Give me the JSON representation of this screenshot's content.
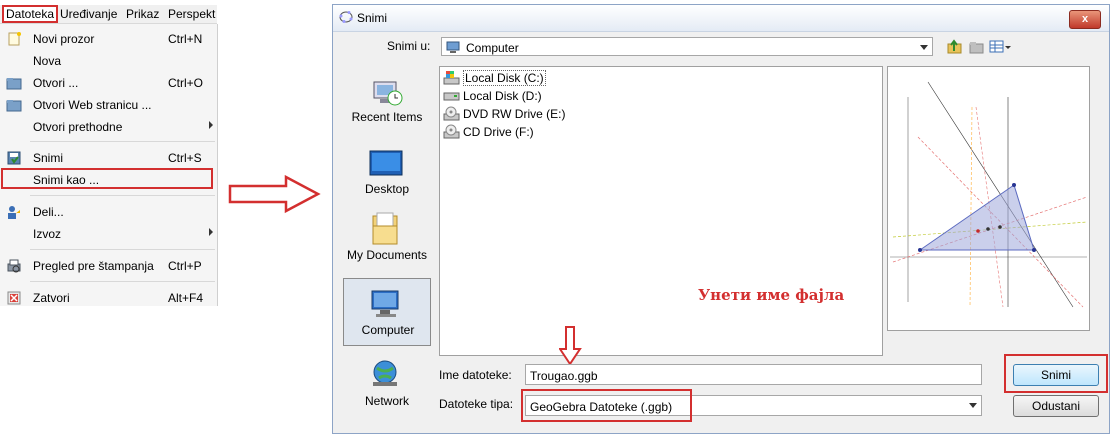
{
  "menubar": {
    "items": [
      "Datoteka",
      "Uređivanje",
      "Prikaz",
      "Perspekt"
    ]
  },
  "menu": {
    "items": [
      {
        "label": "Novi prozor",
        "shortcut": "Ctrl+N",
        "icon": "new-window-icon"
      },
      {
        "label": "Nova",
        "shortcut": "",
        "icon": ""
      },
      {
        "label": "Otvori ...",
        "shortcut": "Ctrl+O",
        "icon": "open-folder-icon"
      },
      {
        "label": "Otvori Web stranicu ...",
        "shortcut": "",
        "icon": "open-web-icon"
      },
      {
        "label": "Otvori prethodne",
        "shortcut": "",
        "icon": "",
        "submenu": true
      },
      {
        "label": "Snimi",
        "shortcut": "Ctrl+S",
        "icon": "save-icon"
      },
      {
        "label": "Snimi kao ...",
        "shortcut": "",
        "icon": ""
      },
      {
        "label": "Deli...",
        "shortcut": "",
        "icon": "share-icon"
      },
      {
        "label": "Izvoz",
        "shortcut": "",
        "icon": "",
        "submenu": true
      },
      {
        "label": "Pregled pre štampanja",
        "shortcut": "Ctrl+P",
        "icon": "print-preview-icon"
      },
      {
        "label": "Zatvori",
        "shortcut": "Alt+F4",
        "icon": "close-app-icon"
      }
    ]
  },
  "dialog": {
    "title": "Snimi",
    "close": "x",
    "save_in_label": "Snimi u:",
    "save_in_value": "Computer",
    "places": [
      "Recent Items",
      "Desktop",
      "My Documents",
      "Computer",
      "Network"
    ],
    "files": [
      "Local Disk (C:)",
      "Local Disk (D:)",
      "DVD RW Drive (E:)",
      "CD Drive (F:)"
    ],
    "annotation": "Унети име фајла",
    "filename_label": "Ime datoteke:",
    "filename_value": "Trougao.ggb",
    "filetype_label": "Datoteke tipa:",
    "filetype_value": "GeoGebra Datoteke (.ggb)",
    "save_button": "Snimi",
    "cancel_button": "Odustani"
  },
  "colors": {
    "annotation_red": "#d32f2f",
    "dialog_bg": "#f0f0f0",
    "accent_blue": "#3c7fb1"
  }
}
